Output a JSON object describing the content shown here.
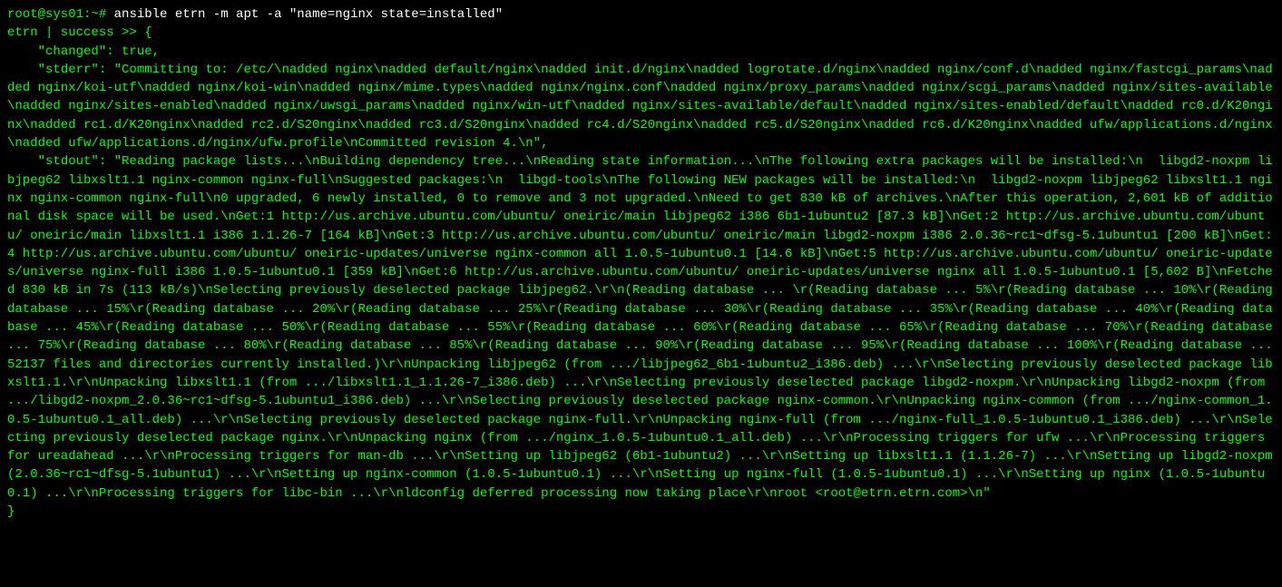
{
  "prompt": {
    "user_host": "root@sys01",
    "path": ":~#",
    "command": " ansible etrn -m apt -a \"name=nginx state=installed\""
  },
  "output": {
    "line1": "etrn | success >> {",
    "line2": "    \"changed\": true,",
    "line3": "    \"stderr\": \"Committing to: /etc/\\nadded nginx\\nadded default/nginx\\nadded init.d/nginx\\nadded logrotate.d/nginx\\nadded nginx/conf.d\\nadded nginx/fastcgi_params\\nadded nginx/koi-utf\\nadded nginx/koi-win\\nadded nginx/mime.types\\nadded nginx/nginx.conf\\nadded nginx/proxy_params\\nadded nginx/scgi_params\\nadded nginx/sites-available\\nadded nginx/sites-enabled\\nadded nginx/uwsgi_params\\nadded nginx/win-utf\\nadded nginx/sites-available/default\\nadded nginx/sites-enabled/default\\nadded rc0.d/K20nginx\\nadded rc1.d/K20nginx\\nadded rc2.d/S20nginx\\nadded rc3.d/S20nginx\\nadded rc4.d/S20nginx\\nadded rc5.d/S20nginx\\nadded rc6.d/K20nginx\\nadded ufw/applications.d/nginx\\nadded ufw/applications.d/nginx/ufw.profile\\nCommitted revision 4.\\n\",",
    "line4": "    \"stdout\": \"Reading package lists...\\nBuilding dependency tree...\\nReading state information...\\nThe following extra packages will be installed:\\n  libgd2-noxpm libjpeg62 libxslt1.1 nginx-common nginx-full\\nSuggested packages:\\n  libgd-tools\\nThe following NEW packages will be installed:\\n  libgd2-noxpm libjpeg62 libxslt1.1 nginx nginx-common nginx-full\\n0 upgraded, 6 newly installed, 0 to remove and 3 not upgraded.\\nNeed to get 830 kB of archives.\\nAfter this operation, 2,601 kB of additional disk space will be used.\\nGet:1 http://us.archive.ubuntu.com/ubuntu/ oneiric/main libjpeg62 i386 6b1-1ubuntu2 [87.3 kB]\\nGet:2 http://us.archive.ubuntu.com/ubuntu/ oneiric/main libxslt1.1 i386 1.1.26-7 [164 kB]\\nGet:3 http://us.archive.ubuntu.com/ubuntu/ oneiric/main libgd2-noxpm i386 2.0.36~rc1~dfsg-5.1ubuntu1 [200 kB]\\nGet:4 http://us.archive.ubuntu.com/ubuntu/ oneiric-updates/universe nginx-common all 1.0.5-1ubuntu0.1 [14.6 kB]\\nGet:5 http://us.archive.ubuntu.com/ubuntu/ oneiric-updates/universe nginx-full i386 1.0.5-1ubuntu0.1 [359 kB]\\nGet:6 http://us.archive.ubuntu.com/ubuntu/ oneiric-updates/universe nginx all 1.0.5-1ubuntu0.1 [5,602 B]\\nFetched 830 kB in 7s (113 kB/s)\\nSelecting previously deselected package libjpeg62.\\r\\n(Reading database ... \\r(Reading database ... 5%\\r(Reading database ... 10%\\r(Reading database ... 15%\\r(Reading database ... 20%\\r(Reading database ... 25%\\r(Reading database ... 30%\\r(Reading database ... 35%\\r(Reading database ... 40%\\r(Reading database ... 45%\\r(Reading database ... 50%\\r(Reading database ... 55%\\r(Reading database ... 60%\\r(Reading database ... 65%\\r(Reading database ... 70%\\r(Reading database ... 75%\\r(Reading database ... 80%\\r(Reading database ... 85%\\r(Reading database ... 90%\\r(Reading database ... 95%\\r(Reading database ... 100%\\r(Reading database ... 52137 files and directories currently installed.)\\r\\nUnpacking libjpeg62 (from .../libjpeg62_6b1-1ubuntu2_i386.deb) ...\\r\\nSelecting previously deselected package libxslt1.1.\\r\\nUnpacking libxslt1.1 (from .../libxslt1.1_1.1.26-7_i386.deb) ...\\r\\nSelecting previously deselected package libgd2-noxpm.\\r\\nUnpacking libgd2-noxpm (from .../libgd2-noxpm_2.0.36~rc1~dfsg-5.1ubuntu1_i386.deb) ...\\r\\nSelecting previously deselected package nginx-common.\\r\\nUnpacking nginx-common (from .../nginx-common_1.0.5-1ubuntu0.1_all.deb) ...\\r\\nSelecting previously deselected package nginx-full.\\r\\nUnpacking nginx-full (from .../nginx-full_1.0.5-1ubuntu0.1_i386.deb) ...\\r\\nSelecting previously deselected package nginx.\\r\\nUnpacking nginx (from .../nginx_1.0.5-1ubuntu0.1_all.deb) ...\\r\\nProcessing triggers for ufw ...\\r\\nProcessing triggers for ureadahead ...\\r\\nProcessing triggers for man-db ...\\r\\nSetting up libjpeg62 (6b1-1ubuntu2) ...\\r\\nSetting up libxslt1.1 (1.1.26-7) ...\\r\\nSetting up libgd2-noxpm (2.0.36~rc1~dfsg-5.1ubuntu1) ...\\r\\nSetting up nginx-common (1.0.5-1ubuntu0.1) ...\\r\\nSetting up nginx-full (1.0.5-1ubuntu0.1) ...\\r\\nSetting up nginx (1.0.5-1ubuntu0.1) ...\\r\\nProcessing triggers for libc-bin ...\\r\\nldconfig deferred processing now taking place\\r\\nroot <root@etrn.etrn.com>\\n\"",
    "line5": "}"
  }
}
